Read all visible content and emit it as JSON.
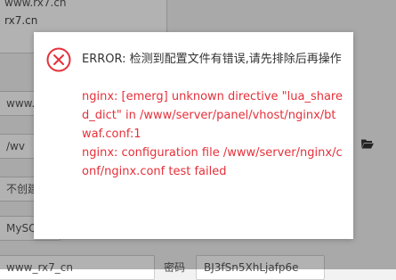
{
  "background": {
    "textarea": {
      "line1": "www.rx7.cn",
      "line2": "rx7.cn"
    },
    "field1": "www.",
    "field2": "/wv",
    "field3": "不创建",
    "field4": "MySQ",
    "field5": "www_rx7_cn",
    "password_label": "密码",
    "password_value": "BJ3fSn5XhLjafp6e",
    "folder_icon": "folder-open-icon"
  },
  "dialog": {
    "icon": "error-circle-x-icon",
    "title": "ERROR: 检测到配置文件有错误,请先排除后再操作",
    "error_line1": "nginx: [emerg] unknown directive \"lua_shared_dict\" in /www/server/panel/vhost/nginx/btwaf.conf:1",
    "error_line2": "nginx: configuration file /www/server/nginx/conf/nginx.conf test failed",
    "colors": {
      "error_red": "#e5303a",
      "icon_red": "#e5303a"
    }
  }
}
